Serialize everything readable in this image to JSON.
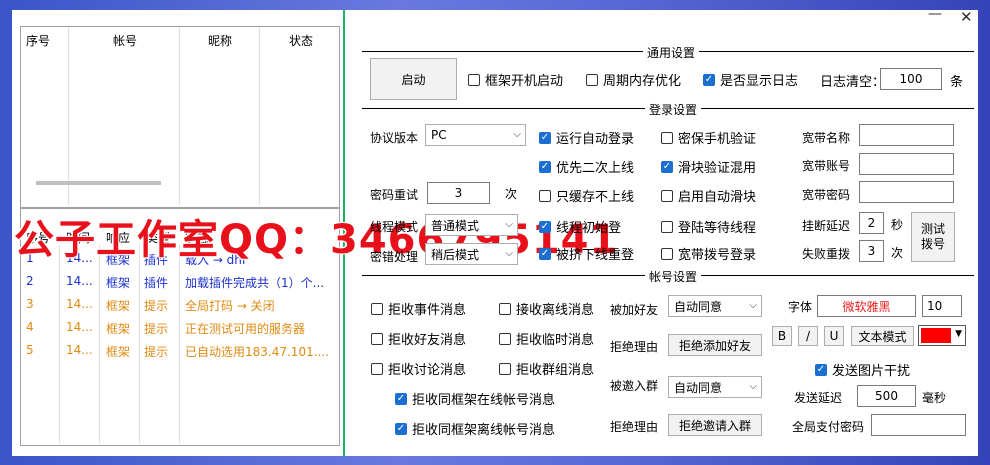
{
  "window": {
    "minimize": "—",
    "close": "✕"
  },
  "top_list": {
    "headers": [
      "序号",
      "帐号",
      "昵称",
      "状态"
    ]
  },
  "log": {
    "headers": [
      "序号",
      "时间",
      "响应",
      "类型",
      "状态"
    ],
    "rows": [
      {
        "no": "1",
        "time": "14...",
        "resp": "框架",
        "type": "插件",
        "status": "载入 → dhf",
        "color": "blue"
      },
      {
        "no": "2",
        "time": "14...",
        "resp": "框架",
        "type": "插件",
        "status": "加载插件完成共（1）个...",
        "color": "blue"
      },
      {
        "no": "3",
        "time": "14...",
        "resp": "框架",
        "type": "提示",
        "status": "全局打码 → 关闭",
        "color": "orange"
      },
      {
        "no": "4",
        "time": "14...",
        "resp": "框架",
        "type": "提示",
        "status": "正在测试可用的服务器",
        "color": "orange"
      },
      {
        "no": "5",
        "time": "14...",
        "resp": "框架",
        "type": "提示",
        "status": "已自动选用183.47.101....",
        "color": "orange"
      }
    ]
  },
  "watermark": "公子工作室QQ：3466795141",
  "general": {
    "title": "通用设置",
    "start": "启动",
    "cb1": "框架开机启动",
    "cb2": "周期内存优化",
    "cb3": "是否显示日志",
    "log_clear_label": "日志清空：",
    "log_clear_value": "100",
    "log_clear_unit": "条"
  },
  "login": {
    "title": "登录设置",
    "protocol_label": "协议版本",
    "protocol_value": "PC",
    "cb_autologin": "运行自动登录",
    "cb_pwdphone": "密保手机验证",
    "cb_secondary": "优先二次上线",
    "cb_slider": "滑块验证混用",
    "pwd_retry_label": "密码重试",
    "pwd_retry_value": "3",
    "pwd_retry_unit": "次",
    "cb_cacheonly": "只缓存不上线",
    "cb_autoslide": "启用自动滑块",
    "thread_label": "线程模式",
    "thread_value": "普通模式",
    "cb_login_a": "线程初始登",
    "cb_waitthread": "登陆等待线程",
    "pwdproc_label": "密错处理",
    "pwdproc_value": "稍后模式",
    "cb_squeezed": "被挤下线重登",
    "cb_dialup": "宽带拨号登录",
    "bb_name": "宽带名称",
    "bb_account": "宽带账号",
    "bb_pwd": "宽带密码",
    "dc_delay_label": "挂断延迟",
    "dc_delay_value": "2",
    "dc_delay_unit": "秒",
    "fail_label": "失败重拨",
    "fail_value": "3",
    "fail_unit": "次",
    "test_dial": "测试拨号"
  },
  "account": {
    "title": "帐号设置",
    "rej_event": "拒收事件消息",
    "recv_offline": "接收离线消息",
    "rej_friend": "拒收好友消息",
    "rej_temp": "拒收临时消息",
    "rej_discuss": "拒收讨论消息",
    "rej_group": "拒收群组消息",
    "rej_same_online": "拒收同框架在线帐号消息",
    "rej_same_offline": "拒收同框架离线帐号消息",
    "friend_label": "被加好友",
    "friend_value": "自动同意",
    "reason1_label": "拒绝理由",
    "reason1_value": "拒绝添加好友",
    "invite_label": "被邀入群",
    "invite_value": "自动同意",
    "reason2_label": "拒绝理由",
    "reason2_value": "拒绝邀请入群",
    "font_label": "字体",
    "font_value": "微软雅黑",
    "font_size": "10",
    "bold": "B",
    "italic": "/",
    "underline": "U",
    "text_mode": "文本模式",
    "send_img": "发送图片干扰",
    "send_delay_label": "发送延迟",
    "send_delay_value": "500",
    "send_delay_unit": "毫秒",
    "pay_pwd_label": "全局支付密码"
  },
  "colors": {
    "accent": "#1a6fd0",
    "red": "#ff0000",
    "watermark": "#e8101a"
  }
}
